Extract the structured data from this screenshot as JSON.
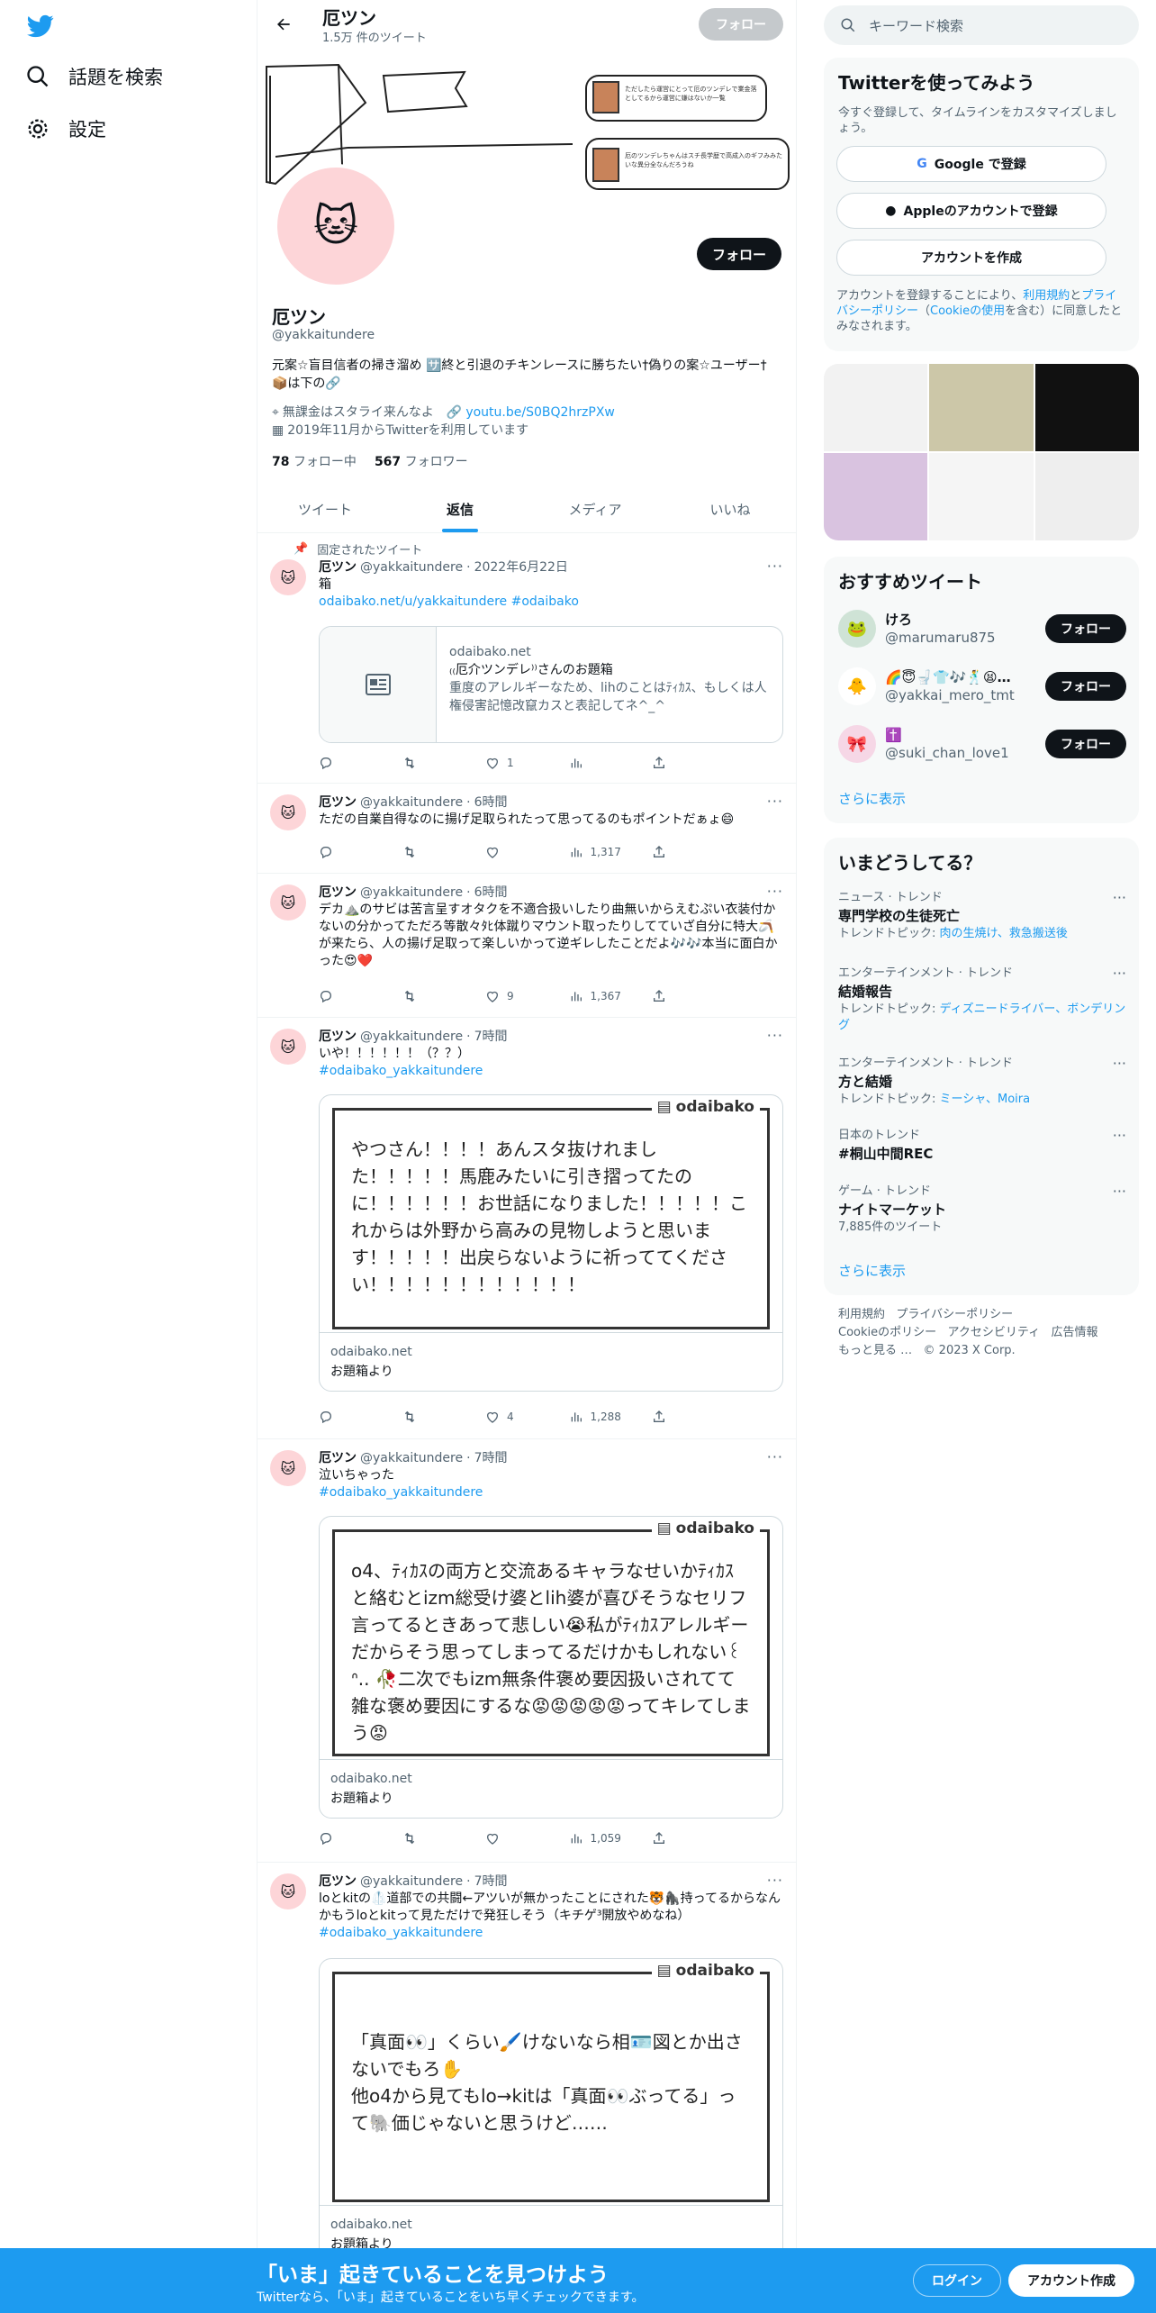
{
  "nav": {
    "explore": "話題を検索",
    "settings": "設定"
  },
  "topbar": {
    "name": "厄ツン",
    "tweet_count": "1.5万 件のツイート",
    "follow": "フォロー"
  },
  "banner": {
    "note1": "ただしたら運営にとって厄のツンデレで業金落としてるから運営に嫌はないか一覧",
    "note2": "厄のツンデレちゃんはスチ長学歴で高成入のギフみみたいな異分全なんだろうね"
  },
  "profile": {
    "follow": "フォロー",
    "name": "厄ツン",
    "handle": "@yakkaitundere",
    "bio": "元案☆盲目信者の掃き溜め 🈂️終と引退のチキンレースに勝ちたい†偽りの案☆ユーザー† 📦は下の🔗",
    "location": "無課金はスタライ来んなよ",
    "link": "youtu.be/S0BQ2hrzPXw",
    "joined": "2019年11月からTwitterを利用しています",
    "following_count": "78",
    "following_label": "フォロー中",
    "followers_count": "567",
    "followers_label": "フォロワー"
  },
  "tabs": [
    "ツイート",
    "返信",
    "メディア",
    "いいね"
  ],
  "pinned_label": "固定されたツイート",
  "tweets": [
    {
      "name": "厄ツン",
      "handle": "@yakkaitundere",
      "time": "2022年6月22日",
      "text": "箱",
      "link": "odaibako.net/u/yakkaitundere",
      "tag": "#odaibako",
      "card": {
        "domain": "odaibako.net",
        "title": "₍₍厄介ツンデレ⁾⁾さんのお題箱",
        "desc": "重度のアレルギーなため、lihのことはﾃｨｶｽ、もしくは人権侵害記憶改竄カスと表記してネ^_^"
      },
      "reply": "",
      "rt": "",
      "like": "1",
      "views": ""
    },
    {
      "name": "厄ツン",
      "handle": "@yakkaitundere",
      "time": "6時間",
      "text": "ただの自業自得なのに揚げ足取られたって思ってるのもポイントだぁょ😄",
      "reply": "",
      "rt": "",
      "like": "",
      "views": "1,317"
    },
    {
      "name": "厄ツン",
      "handle": "@yakkaitundere",
      "time": "6時間",
      "text": "デカ⛰️のサビは苦言呈すオタクを不適合扱いしたり曲無いからえむぷい衣装付かないの分かってただろ等散々ﾀﾋ体蹴りマウント取ったりしてていざ自分に特大🪃が来たら、人の揚げ足取って楽しいかって逆ギレしたことだよ🎶🎶本当に面白かった😍❤️",
      "reply": "",
      "rt": "",
      "like": "9",
      "views": "1,367"
    },
    {
      "name": "厄ツン",
      "handle": "@yakkaitundere",
      "time": "7時間",
      "text": "いや！！！！！！（？？）",
      "tag": "#odaibako_yakkaitundere",
      "odai": "やつさん！！！！あんスタ抜けれました！！！！！馬鹿みたいに引き摺ってたのに！！！！！！お世話になりました！！！！！これからは外野から高みの見物しようと思います！！！！！出戻らないように祈っててください！！！！！！！！！！！！",
      "domain": "odaibako.net",
      "foot": "お題箱より",
      "reply": "",
      "rt": "",
      "like": "4",
      "views": "1,288"
    },
    {
      "name": "厄ツン",
      "handle": "@yakkaitundere",
      "time": "7時間",
      "text": "泣いちゃった",
      "tag": "#odaibako_yakkaitundere",
      "odai": "o4、ﾃｨｶｽの両方と交流あるキャラなせいかﾃｨｶｽと絡むとizm総受け婆とlih婆が喜びそうなセリフ言ってるときあって悲しい😭私がﾃｨｶｽアレルギーだからそう思ってしまってるだけかもしれない꒰ ᐢ.. 🥀二次でもizm無条件褒め要因扱いされてて雑な褒め要因にするな😡😡😡😡😡ってキレてしまう😡",
      "domain": "odaibako.net",
      "foot": "お題箱より",
      "reply": "",
      "rt": "",
      "like": "",
      "views": "1,059"
    },
    {
      "name": "厄ツン",
      "handle": "@yakkaitundere",
      "time": "7時間",
      "text": "loとkitの🥼道部での共闘←アツいが無かったことにされた🐯🦍持ってるからなんかもうloとkitって見ただけで発狂しそう（キチゲ³開放やめなね）",
      "tag": "#odaibako_yakkaitundere",
      "odai": "「真面👀」くらい🖌️けないなら相🪪図とか出さないでもろ✋\n他o4から見てもlo→kitは「真面👀ぶってる」って🐘価じゃないと思うけど……",
      "domain": "odaibako.net",
      "foot": "お題箱より"
    }
  ],
  "right": {
    "search_placeholder": "キーワード検索",
    "signup": {
      "title": "Twitterを使ってみよう",
      "desc": "今すぐ登録して、タイムラインをカスタマイズしましょう。",
      "google": "Google で登録",
      "apple": "Appleのアカウントで登録",
      "create": "アカウントを作成",
      "terms_a": "アカウントを登録することにより、",
      "terms_link1": "利用規約",
      "terms_b": "と",
      "terms_link2": "プライバシーポリシー",
      "terms_c": "（",
      "terms_link3": "Cookieの使用",
      "terms_d": "を含む）に同意したとみなされます。"
    },
    "rec": {
      "title": "おすすめツイート",
      "users": [
        {
          "name": "けろ",
          "handle": "@marumaru875"
        },
        {
          "name": "🌈😇🚽👕🎶🕺😫…",
          "handle": "@yakkai_mero_tmt"
        },
        {
          "name": "✝️",
          "handle": "@suki_chan_love1"
        }
      ],
      "follow": "フォロー",
      "more": "さらに表示"
    },
    "trends": {
      "title": "いまどうしてる？",
      "items": [
        {
          "cat": "ニュース · トレンド",
          "ttl": "専門学校の生徒死亡",
          "sub_label": "トレンドトピック: ",
          "sub_link": "肉の生焼け、救急搬送後"
        },
        {
          "cat": "エンターテインメント · トレンド",
          "ttl": "結婚報告",
          "sub_label": "トレンドトピック: ",
          "sub_link": "ディズニードライバー、ボンデリング"
        },
        {
          "cat": "エンターテインメント · トレンド",
          "ttl": "方と結婚",
          "sub_label": "トレンドトピック: ",
          "sub_link": "ミーシャ、Moira"
        },
        {
          "cat": "日本のトレンド",
          "ttl": "#桐山中間REC",
          "sub_label": "",
          "sub_link": ""
        },
        {
          "cat": "ゲーム · トレンド",
          "ttl": "ナイトマーケット",
          "sub_label": "7,885件のツイート",
          "sub_link": ""
        }
      ],
      "more": "さらに表示"
    },
    "footer": [
      "利用規約",
      "プライバシーポリシー",
      "Cookieのポリシー",
      "アクセシビリティ",
      "広告情報",
      "もっと見る …",
      "© 2023 X Corp."
    ]
  },
  "bottombar": {
    "title": "「いま」起きていることを見つけよう",
    "sub": "Twitterなら、「いま」起きていることをいち早くチェックできます。",
    "login": "ログイン",
    "signup": "アカウント作成"
  },
  "odaibako_brand": "odaibako",
  "colors": {
    "accent": "#1d9bf0",
    "text": "#0f1419",
    "muted": "#536471",
    "avatar_bg": "#fdd5d8"
  }
}
